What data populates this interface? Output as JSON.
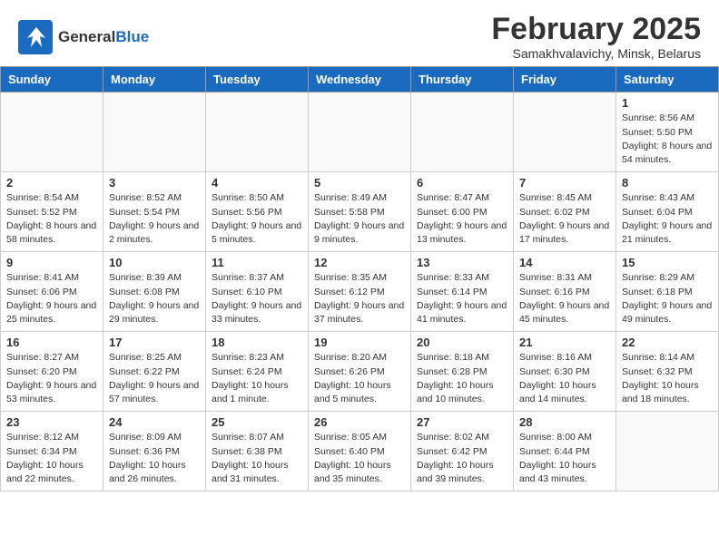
{
  "header": {
    "logo_general": "General",
    "logo_blue": "Blue",
    "title": "February 2025",
    "subtitle": "Samakhvalavichy, Minsk, Belarus"
  },
  "weekdays": [
    "Sunday",
    "Monday",
    "Tuesday",
    "Wednesday",
    "Thursday",
    "Friday",
    "Saturday"
  ],
  "weeks": [
    [
      {
        "day": "",
        "detail": ""
      },
      {
        "day": "",
        "detail": ""
      },
      {
        "day": "",
        "detail": ""
      },
      {
        "day": "",
        "detail": ""
      },
      {
        "day": "",
        "detail": ""
      },
      {
        "day": "",
        "detail": ""
      },
      {
        "day": "1",
        "detail": "Sunrise: 8:56 AM\nSunset: 5:50 PM\nDaylight: 8 hours and 54 minutes."
      }
    ],
    [
      {
        "day": "2",
        "detail": "Sunrise: 8:54 AM\nSunset: 5:52 PM\nDaylight: 8 hours and 58 minutes."
      },
      {
        "day": "3",
        "detail": "Sunrise: 8:52 AM\nSunset: 5:54 PM\nDaylight: 9 hours and 2 minutes."
      },
      {
        "day": "4",
        "detail": "Sunrise: 8:50 AM\nSunset: 5:56 PM\nDaylight: 9 hours and 5 minutes."
      },
      {
        "day": "5",
        "detail": "Sunrise: 8:49 AM\nSunset: 5:58 PM\nDaylight: 9 hours and 9 minutes."
      },
      {
        "day": "6",
        "detail": "Sunrise: 8:47 AM\nSunset: 6:00 PM\nDaylight: 9 hours and 13 minutes."
      },
      {
        "day": "7",
        "detail": "Sunrise: 8:45 AM\nSunset: 6:02 PM\nDaylight: 9 hours and 17 minutes."
      },
      {
        "day": "8",
        "detail": "Sunrise: 8:43 AM\nSunset: 6:04 PM\nDaylight: 9 hours and 21 minutes."
      }
    ],
    [
      {
        "day": "9",
        "detail": "Sunrise: 8:41 AM\nSunset: 6:06 PM\nDaylight: 9 hours and 25 minutes."
      },
      {
        "day": "10",
        "detail": "Sunrise: 8:39 AM\nSunset: 6:08 PM\nDaylight: 9 hours and 29 minutes."
      },
      {
        "day": "11",
        "detail": "Sunrise: 8:37 AM\nSunset: 6:10 PM\nDaylight: 9 hours and 33 minutes."
      },
      {
        "day": "12",
        "detail": "Sunrise: 8:35 AM\nSunset: 6:12 PM\nDaylight: 9 hours and 37 minutes."
      },
      {
        "day": "13",
        "detail": "Sunrise: 8:33 AM\nSunset: 6:14 PM\nDaylight: 9 hours and 41 minutes."
      },
      {
        "day": "14",
        "detail": "Sunrise: 8:31 AM\nSunset: 6:16 PM\nDaylight: 9 hours and 45 minutes."
      },
      {
        "day": "15",
        "detail": "Sunrise: 8:29 AM\nSunset: 6:18 PM\nDaylight: 9 hours and 49 minutes."
      }
    ],
    [
      {
        "day": "16",
        "detail": "Sunrise: 8:27 AM\nSunset: 6:20 PM\nDaylight: 9 hours and 53 minutes."
      },
      {
        "day": "17",
        "detail": "Sunrise: 8:25 AM\nSunset: 6:22 PM\nDaylight: 9 hours and 57 minutes."
      },
      {
        "day": "18",
        "detail": "Sunrise: 8:23 AM\nSunset: 6:24 PM\nDaylight: 10 hours and 1 minute."
      },
      {
        "day": "19",
        "detail": "Sunrise: 8:20 AM\nSunset: 6:26 PM\nDaylight: 10 hours and 5 minutes."
      },
      {
        "day": "20",
        "detail": "Sunrise: 8:18 AM\nSunset: 6:28 PM\nDaylight: 10 hours and 10 minutes."
      },
      {
        "day": "21",
        "detail": "Sunrise: 8:16 AM\nSunset: 6:30 PM\nDaylight: 10 hours and 14 minutes."
      },
      {
        "day": "22",
        "detail": "Sunrise: 8:14 AM\nSunset: 6:32 PM\nDaylight: 10 hours and 18 minutes."
      }
    ],
    [
      {
        "day": "23",
        "detail": "Sunrise: 8:12 AM\nSunset: 6:34 PM\nDaylight: 10 hours and 22 minutes."
      },
      {
        "day": "24",
        "detail": "Sunrise: 8:09 AM\nSunset: 6:36 PM\nDaylight: 10 hours and 26 minutes."
      },
      {
        "day": "25",
        "detail": "Sunrise: 8:07 AM\nSunset: 6:38 PM\nDaylight: 10 hours and 31 minutes."
      },
      {
        "day": "26",
        "detail": "Sunrise: 8:05 AM\nSunset: 6:40 PM\nDaylight: 10 hours and 35 minutes."
      },
      {
        "day": "27",
        "detail": "Sunrise: 8:02 AM\nSunset: 6:42 PM\nDaylight: 10 hours and 39 minutes."
      },
      {
        "day": "28",
        "detail": "Sunrise: 8:00 AM\nSunset: 6:44 PM\nDaylight: 10 hours and 43 minutes."
      },
      {
        "day": "",
        "detail": ""
      }
    ]
  ]
}
